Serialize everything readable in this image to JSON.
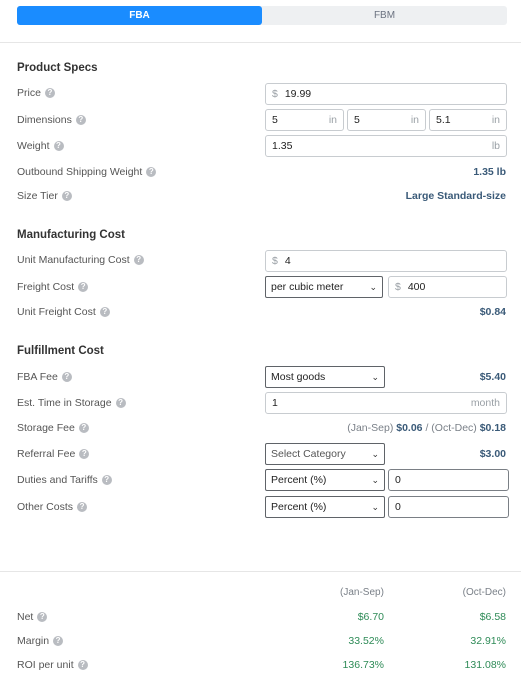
{
  "tabs": [
    {
      "label": "FBA",
      "active": true
    },
    {
      "label": "FBM",
      "active": false
    }
  ],
  "product_specs": {
    "title": "Product Specs",
    "price": {
      "label": "Price",
      "currency": "$",
      "value": "19.99"
    },
    "dimensions": {
      "label": "Dimensions",
      "values": [
        "5",
        "5",
        "5.1"
      ],
      "unit": "in"
    },
    "weight": {
      "label": "Weight",
      "value": "1.35",
      "unit": "lb"
    },
    "outbound_shipping_weight": {
      "label": "Outbound Shipping Weight",
      "value": "1.35 lb"
    },
    "size_tier": {
      "label": "Size Tier",
      "value": "Large Standard-size"
    }
  },
  "manufacturing_cost": {
    "title": "Manufacturing Cost",
    "unit_cost": {
      "label": "Unit Manufacturing Cost",
      "currency": "$",
      "value": "4"
    },
    "freight_cost": {
      "label": "Freight Cost",
      "basis": "per cubic meter",
      "currency": "$",
      "value": "400"
    },
    "unit_freight_cost": {
      "label": "Unit Freight Cost",
      "value": "$0.84"
    }
  },
  "fulfillment_cost": {
    "title": "Fulfillment Cost",
    "fba_fee": {
      "label": "FBA Fee",
      "selected": "Most goods",
      "value": "$5.40"
    },
    "storage_time": {
      "label": "Est. Time in Storage",
      "value": "1",
      "unit": "month"
    },
    "storage_fee": {
      "label": "Storage Fee",
      "period1": "(Jan-Sep)",
      "value1": "$0.06",
      "sep": "/",
      "period2": "(Oct-Dec)",
      "value2": "$0.18"
    },
    "referral_fee": {
      "label": "Referral Fee",
      "selected": "Select Category",
      "value": "$3.00"
    },
    "duties": {
      "label": "Duties and Tariffs",
      "selected": "Percent (%)",
      "value": "0"
    },
    "other_costs": {
      "label": "Other Costs",
      "selected": "Percent (%)",
      "value": "0"
    }
  },
  "summary": {
    "columns": [
      "(Jan-Sep)",
      "(Oct-Dec)"
    ],
    "rows": [
      {
        "label": "Net",
        "values": [
          "$6.70",
          "$6.58"
        ]
      },
      {
        "label": "Margin",
        "values": [
          "33.52%",
          "32.91%"
        ]
      },
      {
        "label": "ROI per unit",
        "values": [
          "136.73%",
          "131.08%"
        ]
      }
    ]
  },
  "colors": {
    "accent": "#1a8cff",
    "value_blue": "#3a5a78",
    "positive_green": "#2e8b57"
  }
}
